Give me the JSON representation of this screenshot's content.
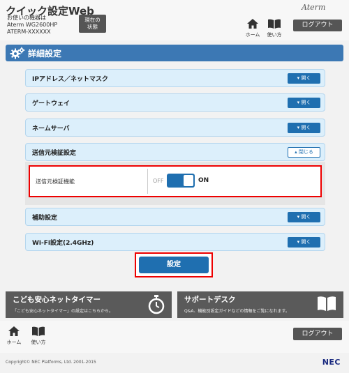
{
  "header": {
    "title": "クイック設定Web",
    "device_label": "お使いの機器は",
    "device_model": "Aterm WG2600HP",
    "device_id": "ATERM-XXXXXX",
    "current_status_button": "現在の\n状態",
    "brand": "Aterm",
    "home_label": "ホーム",
    "help_label": "使い方",
    "logout_label": "ログアウト"
  },
  "section": {
    "title": "詳細設定"
  },
  "accordions": [
    {
      "label": "IPアドレス／ネットマスク",
      "button": "開く",
      "state": "collapsed"
    },
    {
      "label": "ゲートウェイ",
      "button": "開く",
      "state": "collapsed"
    },
    {
      "label": "ネームサーバ",
      "button": "開く",
      "state": "collapsed"
    },
    {
      "label": "送信元検証設定",
      "button": "閉じる",
      "state": "expanded"
    },
    {
      "label": "補助設定",
      "button": "開く",
      "state": "collapsed"
    },
    {
      "label": "Wi-Fi設定(2.4GHz)",
      "button": "開く",
      "state": "collapsed"
    }
  ],
  "source_verification": {
    "field_label": "送信元検証機能",
    "off_label": "OFF",
    "on_label": "ON",
    "value": "ON"
  },
  "submit": {
    "label": "設定"
  },
  "promos": [
    {
      "title": "こども安心ネットタイマー",
      "desc": "「こども安心ネットタイマー」の設定はこちらから。",
      "icon": "stopwatch-icon"
    },
    {
      "title": "サポートデスク",
      "desc": "Q&A、機能別設定ガイドなどの情報をご覧になれます。",
      "icon": "book-icon"
    }
  ],
  "footer": {
    "home_label": "ホーム",
    "help_label": "使い方",
    "logout_label": "ログアウト",
    "copyright": "Copyright© NEC Platforms, Ltd. 2001-2015",
    "logo": "NEC"
  },
  "colors": {
    "accent": "#1f6fb0",
    "section_bar": "#3c78b4",
    "row_bg": "#dceffb",
    "highlight": "#e00000",
    "dark_button": "#555555"
  }
}
